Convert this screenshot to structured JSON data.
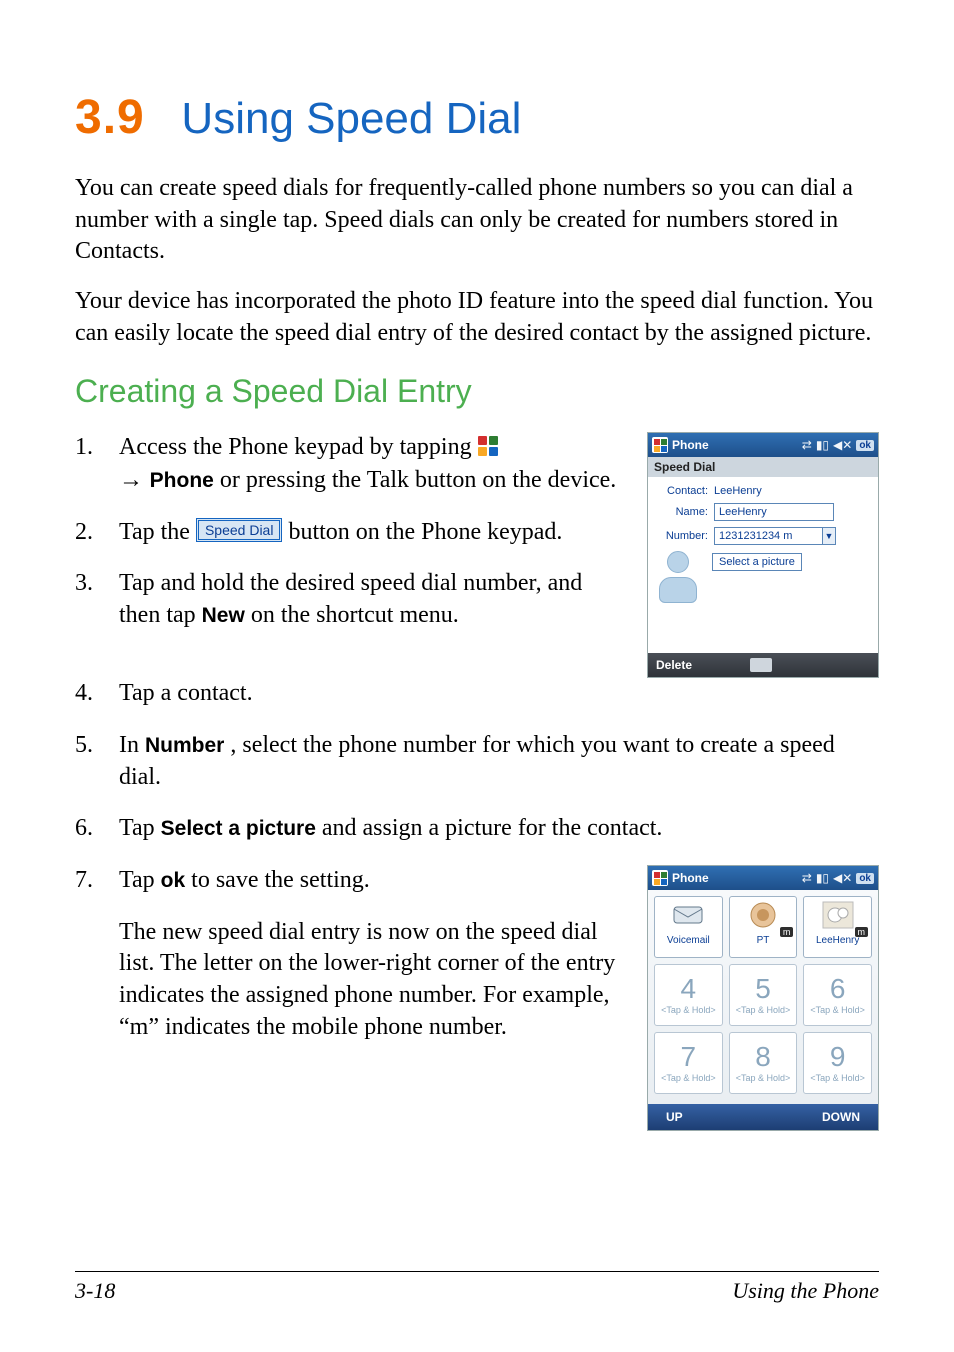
{
  "heading": {
    "number": "3.9",
    "title": "Using Speed Dial"
  },
  "intro": [
    "You can create speed dials for frequently-called phone numbers so you can dial a number with a single tap. Speed dials can only be created for numbers stored in Contacts.",
    "Your device has incorporated the photo ID feature into the speed dial function. You can easily locate the speed dial entry of the desired contact by the assigned picture."
  ],
  "subheading": "Creating a Speed Dial Entry",
  "steps": {
    "s1_a": "Access the Phone keypad by tapping ",
    "s1_arrow": "→ ",
    "s1_phone": "Phone",
    "s1_b": " or pressing the Talk button on the device.",
    "s2_a": "Tap the ",
    "s2_chip": "Speed Dial",
    "s2_b": " button on the Phone keypad.",
    "s3_a": "Tap and hold the desired speed dial number, and then tap ",
    "s3_new": "New",
    "s3_b": " on the shortcut menu.",
    "s4": "Tap a contact.",
    "s5_a": "In ",
    "s5_num": "Number",
    "s5_b": ", select the phone number for which you want to create a speed dial.",
    "s6_a": "Tap ",
    "s6_sel": "Select a picture",
    "s6_b": " and assign a picture for the contact.",
    "s7_a": "Tap ",
    "s7_ok": "ok",
    "s7_b": " to save the setting.",
    "s7_note": "The new speed dial entry is now on the speed dial list. The letter on the lower-right corner of the entry indicates the assigned phone number. For example, “m” indicates the mobile phone number."
  },
  "shot1": {
    "title": "Phone",
    "ok": "ok",
    "header": "Speed Dial",
    "contact_label": "Contact:",
    "contact_value": "LeeHenry",
    "name_label": "Name:",
    "name_value": "LeeHenry",
    "number_label": "Number:",
    "number_value": "1231231234 m",
    "select_picture": "Select a picture",
    "delete": "Delete"
  },
  "shot2": {
    "title": "Phone",
    "ok": "ok",
    "row1": [
      "Voicemail",
      "PT",
      "LeeHenry"
    ],
    "mbadge": "m",
    "row2": [
      "4",
      "5",
      "6"
    ],
    "row3": [
      "7",
      "8",
      "9"
    ],
    "taphold": "<Tap & Hold>",
    "soft_left": "UP",
    "soft_right": "DOWN"
  },
  "footer": {
    "page": "3-18",
    "section": "Using the Phone"
  }
}
